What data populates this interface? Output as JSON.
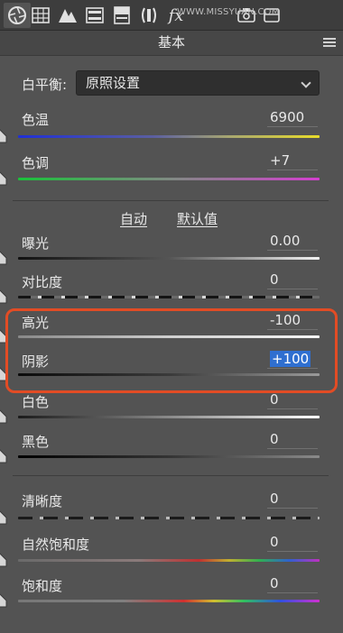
{
  "toolbar": {
    "icons": [
      "aperture-icon",
      "tone-curve-grid-icon",
      "mountains-icon",
      "hsl-bars-icon",
      "split-toning-icon",
      "detail-icon",
      "fx-icon",
      "camera-calibration-icon",
      "lens-icon"
    ],
    "watermark": "WWW.MISSYUAN.COM"
  },
  "panel": {
    "title": "基本"
  },
  "white_balance": {
    "label": "白平衡:",
    "value": "原照设置"
  },
  "sliders": {
    "temperature": {
      "label": "色温",
      "value": "6900",
      "position": 0.49
    },
    "tint": {
      "label": "色调",
      "value": "+7",
      "position": 0.53
    },
    "exposure": {
      "label": "曝光",
      "value": "0.00",
      "position": 0.5
    },
    "contrast": {
      "label": "对比度",
      "value": "0",
      "position": 0.5
    },
    "highlights": {
      "label": "高光",
      "value": "-100",
      "position": 0.0
    },
    "shadows": {
      "label": "阴影",
      "value": "+100",
      "position": 1.0
    },
    "whites": {
      "label": "白色",
      "value": "0",
      "position": 0.5
    },
    "blacks": {
      "label": "黑色",
      "value": "0",
      "position": 0.5
    },
    "clarity": {
      "label": "清晰度",
      "value": "0",
      "position": 0.5
    },
    "vibrance": {
      "label": "自然饱和度",
      "value": "0",
      "position": 0.5
    },
    "saturation": {
      "label": "饱和度",
      "value": "0",
      "position": 0.5
    }
  },
  "tone": {
    "auto_label": "自动",
    "default_label": "默认值"
  },
  "colors": {
    "accent": "#2f6fd0",
    "highlight_frame": "#e24c25",
    "panel_bg": "#535353"
  }
}
